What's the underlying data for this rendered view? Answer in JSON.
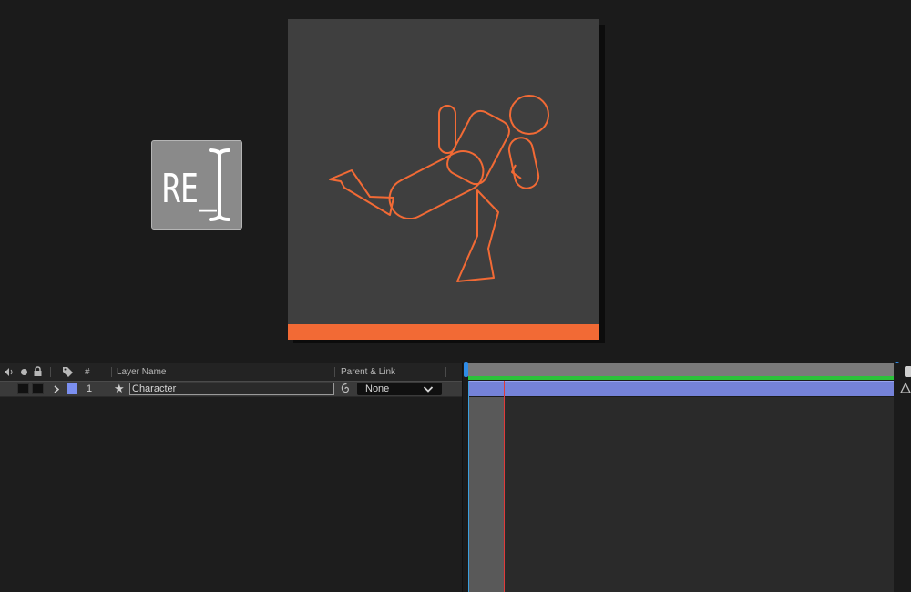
{
  "logo": {
    "text": "RE_"
  },
  "colors": {
    "accent": "#f26a35",
    "comp_bg": "#3f3f3f",
    "layer_label": "#7b8ff0",
    "work_area": "#2bc23a",
    "playhead": "#e03a3a"
  },
  "timeline": {
    "headers": {
      "number": "#",
      "layer_name": "Layer Name",
      "parent_link": "Parent & Link"
    },
    "header_icons": [
      "audio-icon",
      "visibility-icon",
      "lock-icon",
      "label-tag-icon"
    ],
    "layers": [
      {
        "number": "1",
        "name": "Character",
        "parent": "None",
        "label_color": "#7b8ff0",
        "icons": [
          "expand-arrow-icon",
          "shape-layer-star-icon",
          "pickwhip-icon",
          "chevron-down-icon"
        ]
      }
    ]
  }
}
